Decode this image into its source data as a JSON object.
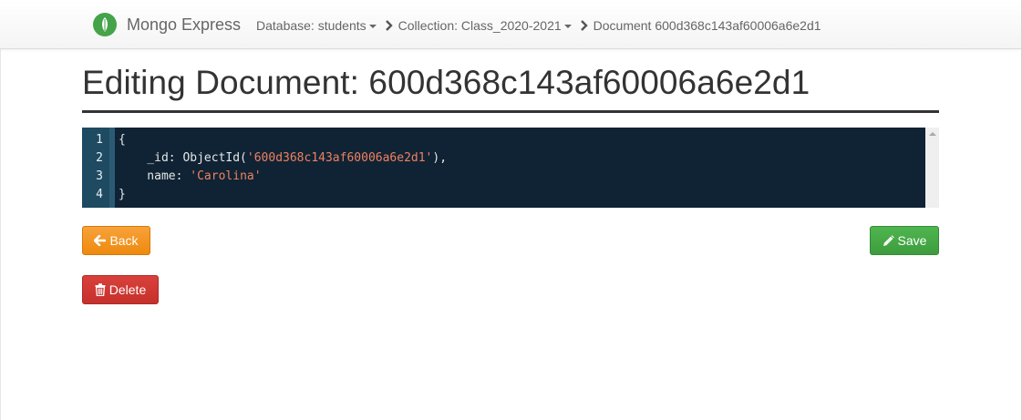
{
  "navbar": {
    "brand": "Mongo Express",
    "breadcrumbs": [
      {
        "label": "Database: students",
        "has_caret": true
      },
      {
        "label": "Collection: Class_2020-2021",
        "has_caret": true
      },
      {
        "label": "Document 600d368c143af60006a6e2d1",
        "has_caret": false
      }
    ],
    "brand_color": "#45a34a"
  },
  "page": {
    "title": "Editing Document: 600d368c143af60006a6e2d1"
  },
  "editor": {
    "line_numbers": [
      "1",
      "2",
      "3",
      "4"
    ],
    "lines": [
      {
        "pre": "{",
        "str": "",
        "post": ""
      },
      {
        "pre": "    _id: ObjectId(",
        "str": "'600d368c143af60006a6e2d1'",
        "post": "),"
      },
      {
        "pre": "    name: ",
        "str": "'Carolina'",
        "post": ""
      },
      {
        "pre": "}",
        "str": "",
        "post": ""
      }
    ],
    "background": "#0f2335",
    "string_color": "#f1805e"
  },
  "actions": {
    "back_label": "Back",
    "save_label": "Save",
    "delete_label": "Delete"
  },
  "icons": {
    "brand": "leaf-icon",
    "breadcrumb_separator": "chevron-right-icon",
    "back": "arrow-left-icon",
    "save": "pencil-icon",
    "delete": "trash-icon"
  }
}
